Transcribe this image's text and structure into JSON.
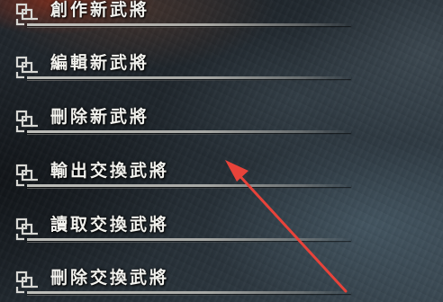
{
  "menu": {
    "items": [
      {
        "label": "創作新武將"
      },
      {
        "label": "編輯新武將"
      },
      {
        "label": "刪除新武將"
      },
      {
        "label": "輸出交換武將"
      },
      {
        "label": "讀取交換武將"
      },
      {
        "label": "刪除交換武將"
      }
    ]
  },
  "annotation": {
    "icon": "red-arrow-icon",
    "color": "#e8433a"
  },
  "colors": {
    "label_text": "#f2f2ee",
    "rule": "#c8c8c3",
    "background": "#1f262c"
  }
}
